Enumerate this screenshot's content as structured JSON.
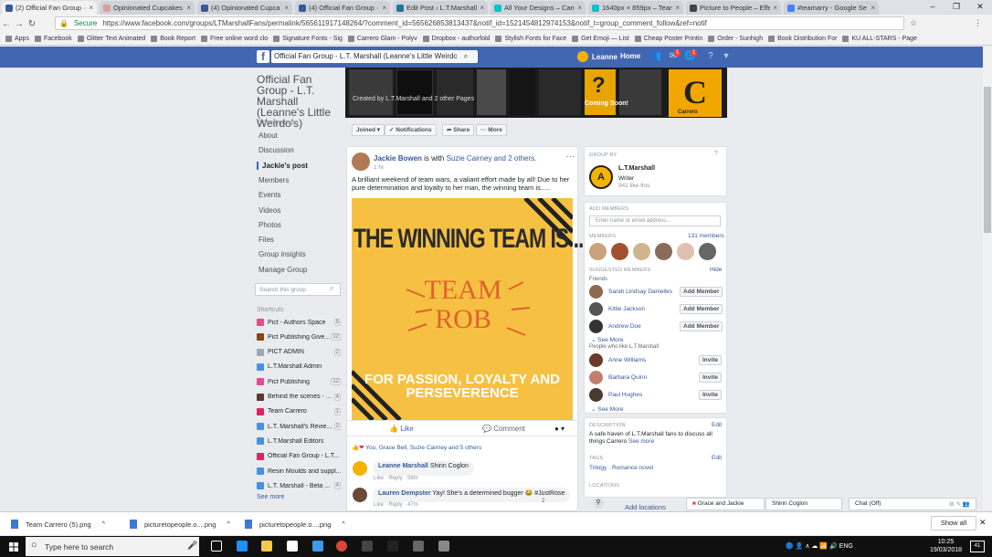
{
  "browser": {
    "tabs": [
      {
        "title": "(2) Official Fan Group ·",
        "color": "#3b5998",
        "active": true
      },
      {
        "title": "Opinionated Cupcakes",
        "color": "#d9a0a0"
      },
      {
        "title": "(4) Opinionated Cupca",
        "color": "#3b5998"
      },
      {
        "title": "(4) Official Fan Group ·",
        "color": "#3b5998"
      },
      {
        "title": "Edit Post ‹ L.T.Marshall",
        "color": "#21759b"
      },
      {
        "title": "All Your Designs – Canv",
        "color": "#00c4cc"
      },
      {
        "title": "1640px × 859px – Tean",
        "color": "#00c4cc"
      },
      {
        "title": "Picture to People – Effe",
        "color": "#444444"
      },
      {
        "title": "#teamarry - Google Se",
        "color": "#4285f4"
      }
    ],
    "window_controls": [
      "–",
      "❐",
      "✕"
    ],
    "secure_label": "Secure",
    "url": "https://www.facebook.com/groups/LTMarshallFans/permalink/565611917148264/?comment_id=565626853813437&notif_id=1521454812974153&notif_t=group_comment_follow&ref=notif",
    "bookmarks": [
      "Apps",
      "Facebook",
      "Glitter Text Animated",
      "Book Report",
      "Free online word clo",
      "Signature Fonts - Sig",
      "Carrero Glam - Polyv",
      "Dropbox - authorfold",
      "Stylish Fonts for Face",
      "Get Emoji — List",
      "Cheap Poster Printin",
      "Order - Sunhigh",
      "Book Distribution For",
      "KU ALL-STARS - Page"
    ]
  },
  "fb_header": {
    "logo": "f",
    "search_value": "Official Fan Group - L.T. Marshall (Leanne's Little Weirdo's)",
    "user_name": "Leanne",
    "home_label": "Home",
    "badge_messages": "1",
    "badge_notifications": "1"
  },
  "group": {
    "title": "Official Fan Group - L.T. Marshall (Leanne's Little Weirdo's)",
    "type": "Closed group",
    "nav": [
      "About",
      "Discussion",
      "Jackie's post",
      "Members",
      "Events",
      "Videos",
      "Photos",
      "Files",
      "Group insights",
      "Manage Group"
    ],
    "search_placeholder": "Search this group",
    "shortcuts_label": "Shortcuts",
    "shortcuts": [
      {
        "label": "Pict - Authors Space",
        "count": "5",
        "color": "#e44b8a"
      },
      {
        "label": "Pict Publishing Give...",
        "count": "12",
        "color": "#8b4513"
      },
      {
        "label": "PICT ADMIN",
        "count": "2",
        "color": "#9ea7b8"
      },
      {
        "label": "L.T.Marshall Admin",
        "count": "",
        "color": "#4a90e2"
      },
      {
        "label": "Pict Publishing",
        "count": "12",
        "color": "#e44b8a"
      },
      {
        "label": "Behind the scenes - ...",
        "count": "4",
        "color": "#5a3a2a"
      },
      {
        "label": "Team Carrero",
        "count": "1",
        "color": "#e0245e"
      },
      {
        "label": "L.T. Marshall's Revie...",
        "count": "2",
        "color": "#4a90e2"
      },
      {
        "label": "L.T.Marshall Editors",
        "count": "",
        "color": "#4a90e2"
      },
      {
        "label": "Official Fan Group - L.T...",
        "count": "",
        "color": "#e0245e"
      },
      {
        "label": "Resin Moulds and suppl...",
        "count": "",
        "color": "#4a90e2"
      },
      {
        "label": "L.T. Marshall - Beta ...",
        "count": "4",
        "color": "#4a90e2"
      }
    ],
    "see_more": "See more",
    "cover_label": "Created by L.T.Marshall and 2 other Pages",
    "coming_soon": "Coming Soon!",
    "carrero_letter": "C",
    "carrero_text": "Carrero",
    "buttons": [
      "Joined ▾",
      "✓ Notifications",
      "➦ Share",
      "··· More"
    ]
  },
  "post": {
    "author": "Jackie Bowen",
    "with_text": "is with",
    "tagged": "Suzie Cairney and 2 others.",
    "time": "1 hr",
    "text": "A brilliant weekend of team wars, a valiant effort made by all! Due to her pure determination and loyalty to her man, the winning team is.....",
    "image_line1": "THE WINNING TEAM IS .....",
    "image_line2": "TEAM",
    "image_line3": "ROB",
    "image_line4": "FOR PASSION, LOYALTY AND PERSEVERENCE",
    "like_label": "Like",
    "comment_label": "Comment",
    "reactions": "You, Grace Bell, Suzie Cairney and 5 others",
    "comments": [
      {
        "name": "Leanne Marshall",
        "text": "Shirin Coglon",
        "meta": "Like · Reply · 58m",
        "color": "#f5b301"
      },
      {
        "name": "Lauren Dempster",
        "text": "Yay! She's a determined bugger 😂 #JustRose",
        "meta": "Like · Reply · 47m",
        "color": "#6b4a3a",
        "reacts": "2"
      }
    ]
  },
  "right": {
    "group_by_label": "Group by",
    "page_name": "L.T.Marshall",
    "page_type": "Writer",
    "page_likes": "941 like this",
    "add_members_label": "Add members",
    "add_members_placeholder": "Enter name or email address...",
    "members_label": "Members",
    "members_count": "131 members",
    "suggested_label": "Suggested members",
    "hide_label": "Hide",
    "friends_label": "Friends",
    "friends": [
      {
        "name": "Sarah Lindsay Danielles",
        "button": "Add Member",
        "color": "#8a6a50"
      },
      {
        "name": "Kittie Jackson",
        "button": "Add Member",
        "color": "#555555"
      },
      {
        "name": "Andrew Doe",
        "button": "Add Member",
        "color": "#333333"
      }
    ],
    "see_more": "See More",
    "likers_label": "People who like L.T.Marshall",
    "likers": [
      {
        "name": "Anne Williams",
        "button": "Invite",
        "color": "#6b3a2a"
      },
      {
        "name": "Barbara Quinn",
        "button": "Invite",
        "color": "#c08070"
      },
      {
        "name": "Paul Hughes",
        "button": "Invite",
        "color": "#4a3a30"
      }
    ],
    "description_label": "Description",
    "edit_label": "Edit",
    "description": "A safe haven of L.T.Marshall fans to discuss all things Carrero",
    "see_more_desc": "See more",
    "tags_label": "Tags",
    "tags": "Trilogy · Romance novel",
    "locations_label": "Locations",
    "add_locations": "Add locations"
  },
  "chat": {
    "tabs": [
      "Grace and Jackie",
      "Shirin Coglon"
    ],
    "status": "Chat (Off)"
  },
  "downloads": {
    "items": [
      "Team Carrero (5).png",
      "picturetopeople.o....png",
      "picturetopeople.o....png"
    ],
    "show_all": "Show all"
  },
  "taskbar": {
    "search_placeholder": "Type here to search",
    "tray_text": "ENG",
    "time": "10:25",
    "date": "19/03/2018",
    "notif_count": "41"
  }
}
